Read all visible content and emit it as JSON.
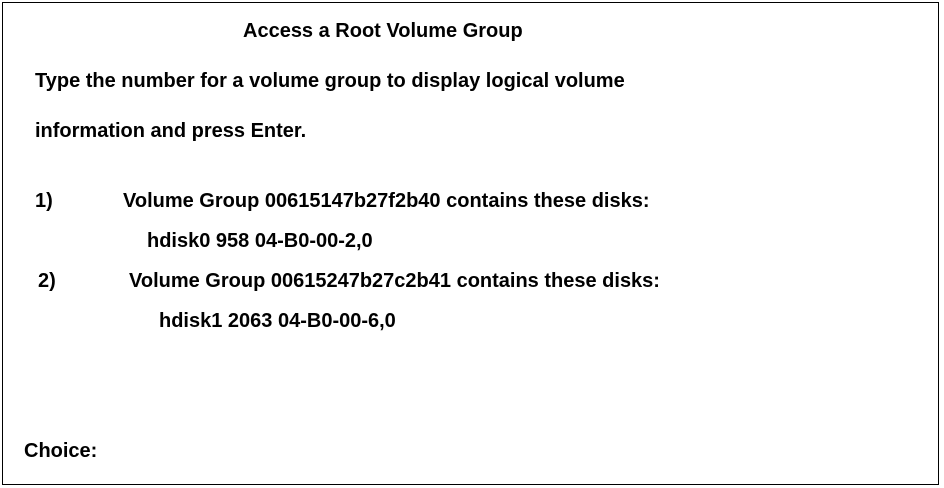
{
  "screen": {
    "title": "Access a Root Volume Group",
    "instructions": [
      "Type the number for a volume group to display logical volume",
      "information and press Enter."
    ]
  },
  "volume_groups": [
    {
      "number": "1)",
      "description": "Volume Group 00615147b27f2b40 contains these disks:",
      "disks": "hdisk0 958 04-B0-00-2,0"
    },
    {
      "number": "2)",
      "description": "Volume Group 00615247b27c2b41 contains these disks:",
      "disks": "hdisk1 2063 04-B0-00-6,0"
    }
  ],
  "prompt": {
    "label": "Choice:",
    "value": ""
  }
}
